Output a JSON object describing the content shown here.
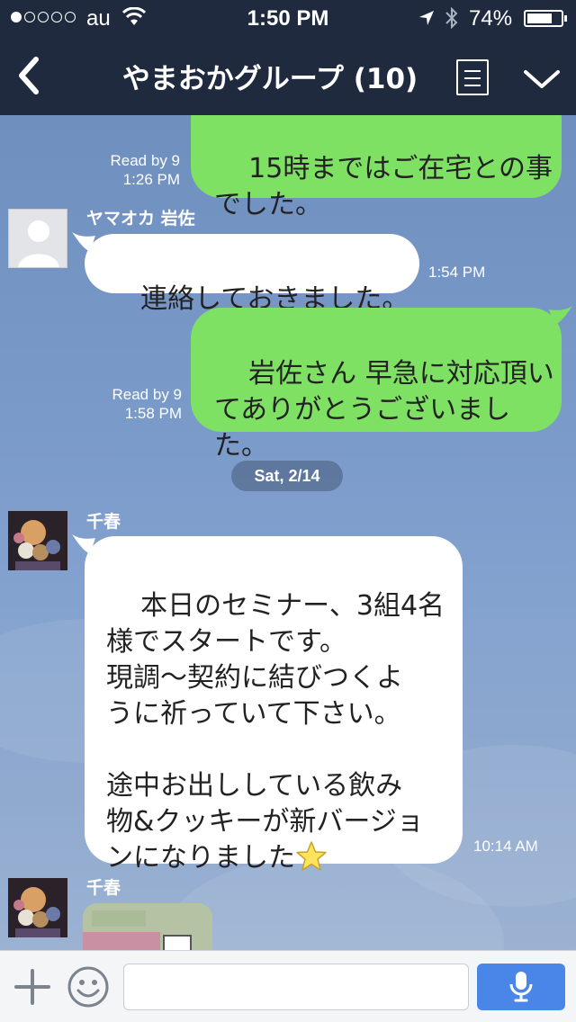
{
  "status_bar": {
    "carrier": "au",
    "time": "1:50 PM",
    "battery_percent": "74%",
    "battery_level": 0.74,
    "signal_bars": 1,
    "signal_total": 5
  },
  "nav": {
    "title": "やまおかグループ (10)",
    "icons": [
      "back-arrow-icon",
      "menu-list-icon",
      "chevron-down-icon"
    ]
  },
  "chat": {
    "messages": [
      {
        "direction": "outgoing",
        "text": "15時まではご在宅との事\nでした。",
        "read": "Read by 9",
        "time": "1:26 PM"
      },
      {
        "direction": "incoming",
        "sender": "ヤマオカ  岩佐",
        "text": "連絡しておきました。",
        "time": "1:54 PM"
      },
      {
        "direction": "outgoing",
        "text": "岩佐さん 早急に対応頂い\nてありがとうございまし\nた。",
        "read": "Read by 9",
        "time": "1:58 PM"
      },
      {
        "direction": "incoming",
        "sender": "千春",
        "text": "本日のセミナー、3組4名\n様でスタートです。\n現調〜契約に結びつくよ\nうに祈っていて下さい。\n\n途中お出ししている飲み\n物&クッキーが新バージョ\nンになりました",
        "emoji": "star-icon",
        "time": "10:14 AM"
      },
      {
        "direction": "incoming",
        "sender": "千春",
        "type": "photo"
      }
    ],
    "date_divider": "Sat, 2/14"
  },
  "input": {
    "placeholder": "",
    "value": "",
    "icons": [
      "plus-icon",
      "smiley-icon",
      "microphone-icon"
    ]
  },
  "colors": {
    "nav_bg": "#1f2a3f",
    "outgoing_bubble": "#7ee163",
    "incoming_bubble": "#ffffff",
    "send_button": "#4a86e8"
  }
}
